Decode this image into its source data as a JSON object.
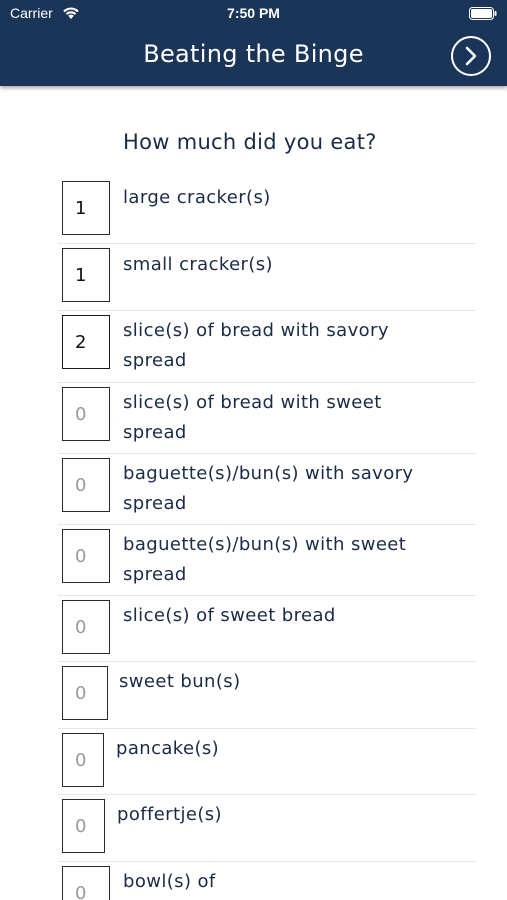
{
  "status": {
    "carrier": "Carrier",
    "time": "7:50 PM"
  },
  "header": {
    "title": "Beating the Binge"
  },
  "question": "How much did you eat?",
  "items": [
    {
      "label": "large cracker(s)",
      "value": "1",
      "placeholder": "0"
    },
    {
      "label": "small cracker(s)",
      "value": "1",
      "placeholder": "0"
    },
    {
      "label": "slice(s) of bread with savory spread",
      "value": "2",
      "placeholder": "0"
    },
    {
      "label": "slice(s) of bread with sweet spread",
      "value": "",
      "placeholder": "0"
    },
    {
      "label": "baguette(s)/bun(s) with savory spread",
      "value": "",
      "placeholder": "0"
    },
    {
      "label": "baguette(s)/bun(s) with sweet spread",
      "value": "",
      "placeholder": "0"
    },
    {
      "label": "slice(s) of sweet bread",
      "value": "",
      "placeholder": "0"
    },
    {
      "label": "sweet bun(s)",
      "value": "",
      "placeholder": "0"
    },
    {
      "label": "pancake(s)",
      "value": "",
      "placeholder": "0"
    },
    {
      "label": "poffertje(s)",
      "value": "",
      "placeholder": "0"
    },
    {
      "label": "bowl(s) of",
      "value": "",
      "placeholder": "0"
    }
  ]
}
